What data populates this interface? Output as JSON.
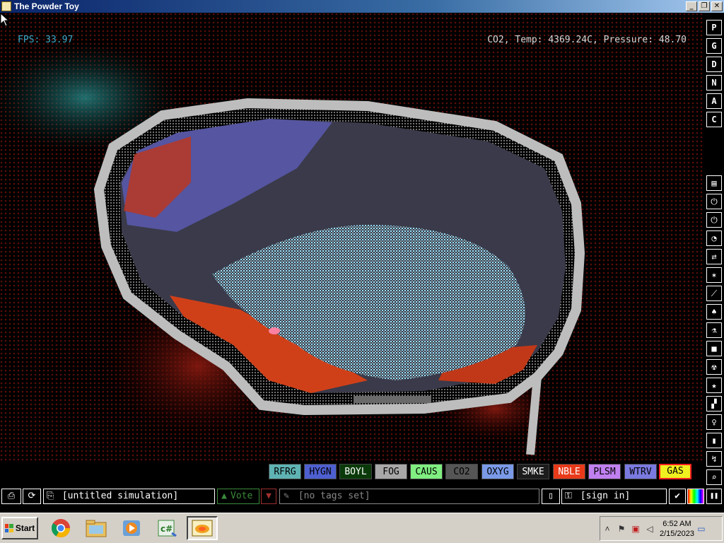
{
  "window": {
    "title": "The Powder Toy",
    "minimize": "_",
    "restore": "❐",
    "close": "✕"
  },
  "hud": {
    "fps": "FPS: 33.97",
    "info": "CO2, Temp: 4369.24C, Pressure: 48.70"
  },
  "side_letters": [
    "P",
    "G",
    "D",
    "N",
    "A",
    "C"
  ],
  "side_tools": [
    "▤",
    "⏻",
    "⏻",
    "◔",
    "⇄",
    "✶",
    "⟋",
    "♠",
    "⚗",
    "■",
    "☢",
    "★",
    "▞",
    "♀",
    "▮",
    "↯",
    "⌕"
  ],
  "elements": [
    {
      "label": "RFRG",
      "bg": "#5fb3b3",
      "fg": "#000000"
    },
    {
      "label": "HYGN",
      "bg": "#4e5fd0",
      "fg": "#000000"
    },
    {
      "label": "BOYL",
      "bg": "#0a3a0a",
      "fg": "#ffffff"
    },
    {
      "label": "FOG",
      "bg": "#a8a8a8",
      "fg": "#000000"
    },
    {
      "label": "CAUS",
      "bg": "#80ee80",
      "fg": "#000000"
    },
    {
      "label": "CO2",
      "bg": "#555555",
      "fg": "#000000"
    },
    {
      "label": "OXYG",
      "bg": "#7a9ae8",
      "fg": "#000000"
    },
    {
      "label": "SMKE",
      "bg": "#1c1c1c",
      "fg": "#ffffff"
    },
    {
      "label": "NBLE",
      "bg": "#e83a1a",
      "fg": "#ffffff"
    },
    {
      "label": "PLSM",
      "bg": "#c080f0",
      "fg": "#000000"
    },
    {
      "label": "WTRV",
      "bg": "#7a7ae0",
      "fg": "#000000"
    },
    {
      "label": "GAS",
      "bg": "#f0f020",
      "fg": "#000000"
    }
  ],
  "bottom": {
    "open_icon": "⎙",
    "reload_icon": "⟳",
    "sim_name": "[untitled simulation]",
    "vote": "Vote",
    "tags": "[no tags set]",
    "sign_in": "[sign in]",
    "pause_icon": "❚❚"
  },
  "taskbar": {
    "start": "Start",
    "time": "6:52 AM",
    "date": "2/15/2023",
    "tray_chevron": "˄"
  },
  "colors": {
    "accent_title": "#0a246a",
    "fps": "#3aa9c8",
    "selected_border": "#ff2020"
  }
}
